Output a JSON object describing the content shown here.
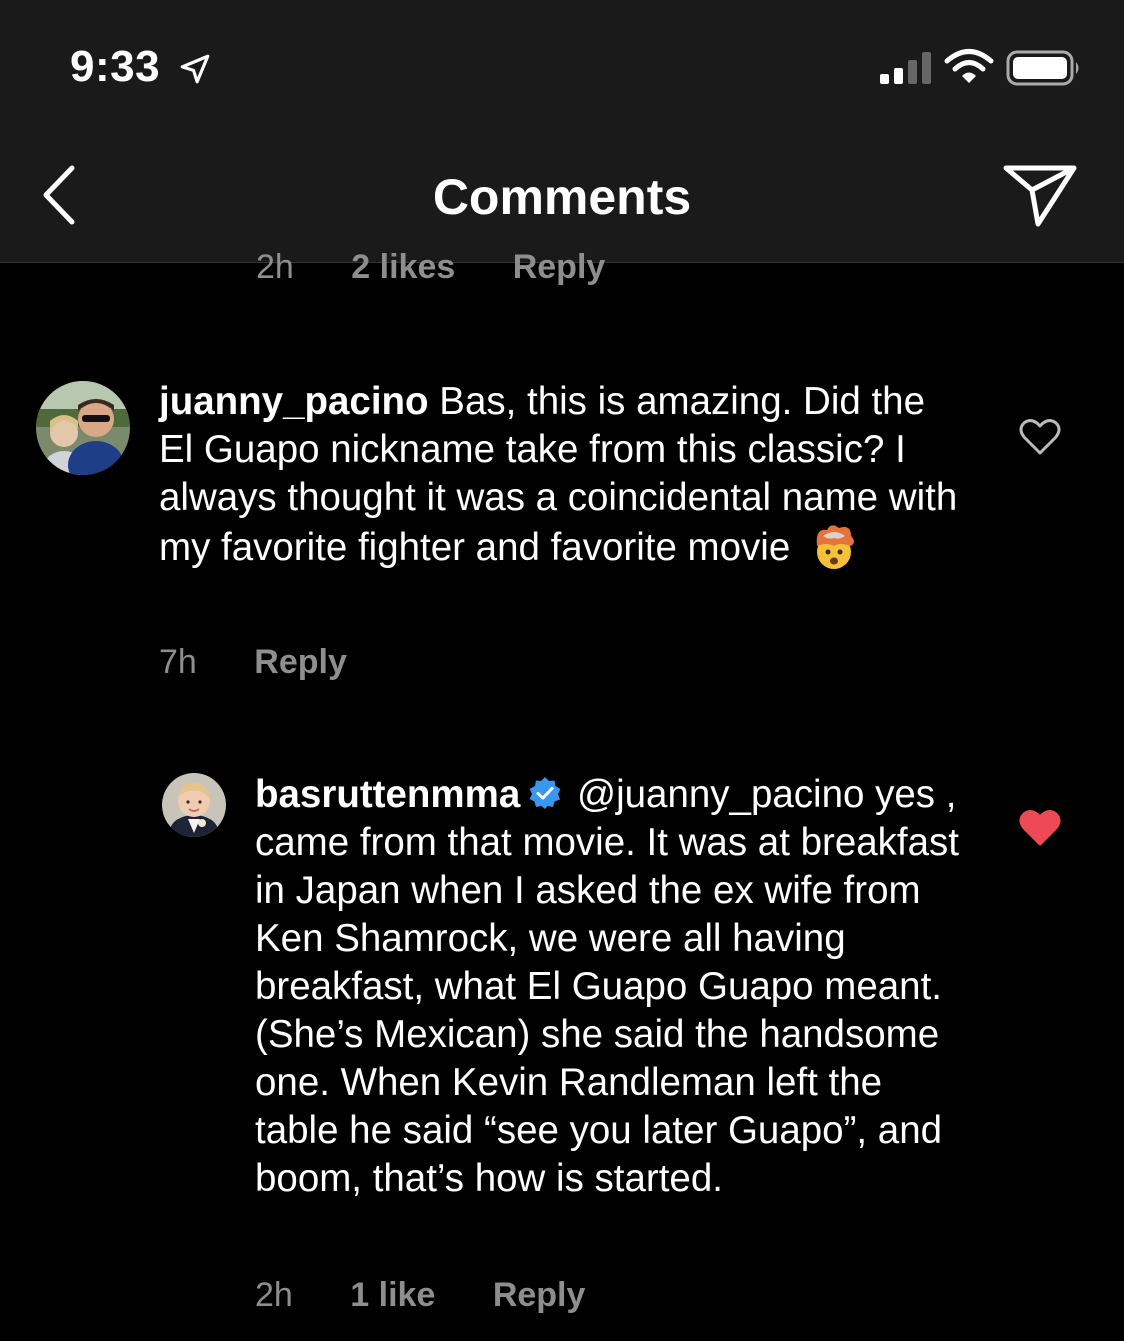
{
  "status_bar": {
    "time": "9:33",
    "icons": [
      "location-arrow-icon",
      "signal-icon",
      "wifi-icon",
      "battery-icon"
    ]
  },
  "nav": {
    "title": "Comments",
    "back_icon": "chevron-left-icon",
    "share_icon": "paper-plane-icon"
  },
  "previous_comment_meta": {
    "time": "2h",
    "likes": "2 likes",
    "reply": "Reply"
  },
  "comments": [
    {
      "username": "juanny_pacino",
      "text": "Bas, this is amazing. Did the El Guapo nickname take from this classic? I always thought it was a coincidental name with my favorite fighter and favorite movie",
      "emoji": "exploding-head-emoji",
      "time": "7h",
      "reply": "Reply",
      "liked": false
    },
    {
      "username": "basruttenmma",
      "verified": true,
      "mention": "@juanny_pacino",
      "text": "yes , came from that movie. It was at breakfast in Japan when I asked the ex wife from Ken Shamrock, we were all having breakfast, what El Guapo Guapo meant. (She’s Mexican) she said the handsome one. When Kevin Randleman left the table he said “see you later Guapo”, and boom, that’s how is started.",
      "time": "2h",
      "likes": "1 like",
      "reply": "Reply",
      "liked": true
    }
  ],
  "colors": {
    "background": "#000000",
    "bar_background": "#1a1a1a",
    "meta_text": "#8e8e8e",
    "like_red": "#ed4956",
    "verified_blue": "#3897f0"
  }
}
